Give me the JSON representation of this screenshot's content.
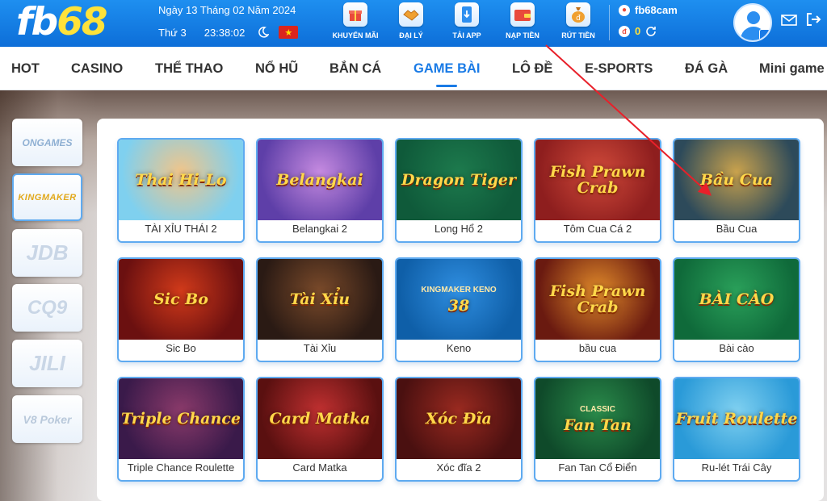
{
  "header": {
    "logo_fb": "fb",
    "logo_num": "68",
    "date": "Ngày 13 Tháng 02 Năm 2024",
    "weekday": "Thứ 3",
    "time": "23:38:02",
    "flag_icon": "vietnam-flag-icon",
    "nav": [
      {
        "label": "KHUYẾN MÃI",
        "icon": "gift-icon"
      },
      {
        "label": "ĐẠI LÝ",
        "icon": "handshake-icon"
      },
      {
        "label": "TẢI APP",
        "icon": "download-app-icon"
      },
      {
        "label": "NẠP TIỀN",
        "icon": "wallet-icon"
      },
      {
        "label": "RÚT TIỀN",
        "icon": "money-bag-icon"
      }
    ],
    "username": "fb68cam",
    "balance": "0"
  },
  "categories": [
    {
      "label": "HOT"
    },
    {
      "label": "CASINO"
    },
    {
      "label": "THỂ THAO"
    },
    {
      "label": "NỔ HŨ"
    },
    {
      "label": "BẮN CÁ"
    },
    {
      "label": "GAME BÀI",
      "active": true
    },
    {
      "label": "LÔ ĐỀ"
    },
    {
      "label": "E-SPORTS"
    },
    {
      "label": "ĐÁ GÀ"
    },
    {
      "label": "Mini game"
    }
  ],
  "providers": [
    {
      "label": "ONGAMES"
    },
    {
      "label": "KINGMAKER",
      "active": true
    },
    {
      "label": "JDB"
    },
    {
      "label": "CQ9"
    },
    {
      "label": "JILI"
    },
    {
      "label": "V8 Poker"
    }
  ],
  "games": [
    {
      "name": "TÀI XỈU THÁI 2",
      "art": "Thai Hi-Lo",
      "bg": "#7fd0ef",
      "bg2": "#f0c58a"
    },
    {
      "name": "Belangkai 2",
      "art": "Belangkai",
      "bg": "#5e3fa8",
      "bg2": "#c58ae0"
    },
    {
      "name": "Long Hổ 2",
      "art": "Dragon Tiger",
      "bg": "#0f5a3a",
      "bg2": "#1d7a4d"
    },
    {
      "name": "Tôm Cua Cá 2",
      "art": "Fish Prawn Crab",
      "bg": "#8e1e1e",
      "bg2": "#d04a3a"
    },
    {
      "name": "Bầu Cua",
      "art": "Bầu Cua",
      "bg": "#2d4a5a",
      "bg2": "#c9a24d"
    },
    {
      "name": "Sic Bo",
      "art": "Sic Bo",
      "bg": "#6b1010",
      "bg2": "#d13a1a"
    },
    {
      "name": "Tài Xỉu",
      "art": "Tài Xỉu",
      "bg": "#2a1a14",
      "bg2": "#7a4a2a"
    },
    {
      "name": "Keno",
      "art": "38",
      "bg": "#0f5fa8",
      "bg2": "#2f8ee0",
      "brand": "KINGMAKER KENO"
    },
    {
      "name": "bầu cua",
      "art": "Fish Prawn Crab",
      "bg": "#6a1a10",
      "bg2": "#e08a2a"
    },
    {
      "name": "Bài cào",
      "art": "BÀI CÀO",
      "bg": "#0f6a3a",
      "bg2": "#2aa05a"
    },
    {
      "name": "Triple Chance Roulette",
      "art": "Triple Chance",
      "bg": "#3a1a4a",
      "bg2": "#8a3a6a"
    },
    {
      "name": "Card Matka",
      "art": "Card Matka",
      "bg": "#5a1010",
      "bg2": "#c03030"
    },
    {
      "name": "Xóc đĩa 2",
      "art": "Xóc Đĩa",
      "bg": "#4a1010",
      "bg2": "#9a2a20"
    },
    {
      "name": "Fan Tan Cổ Điển",
      "art": "Fan Tan",
      "bg": "#0f4a2a",
      "bg2": "#2a8a4a",
      "brand": "CLASSIC"
    },
    {
      "name": "Ru-lét Trái Cây",
      "art": "Fruit Roulette",
      "bg": "#2a9ad8",
      "bg2": "#7fd0f0"
    }
  ],
  "colors": {
    "primary": "#1a7be6",
    "header_top": "#1e8ff0",
    "accent_yellow": "#ffe23a",
    "arrow": "#e8202a"
  }
}
